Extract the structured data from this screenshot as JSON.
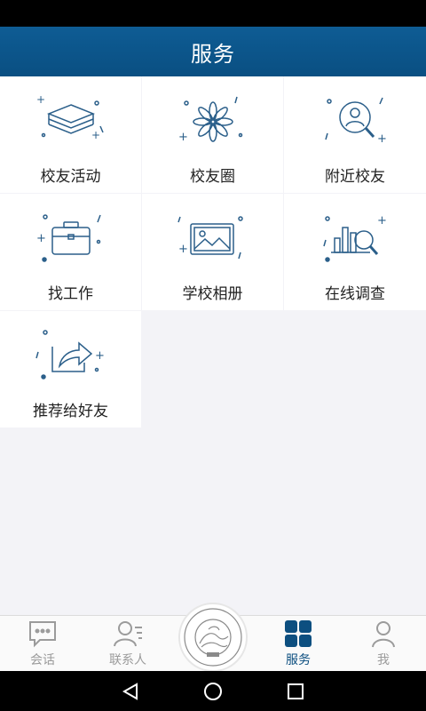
{
  "header": {
    "title": "服务"
  },
  "services": [
    {
      "label": "校友活动",
      "icon": "layers-icon"
    },
    {
      "label": "校友圈",
      "icon": "flower-icon"
    },
    {
      "label": "附近校友",
      "icon": "person-search-icon"
    },
    {
      "label": "找工作",
      "icon": "briefcase-icon"
    },
    {
      "label": "学校相册",
      "icon": "photo-album-icon"
    },
    {
      "label": "在线调查",
      "icon": "chart-search-icon"
    },
    {
      "label": "推荐给好友",
      "icon": "share-icon"
    }
  ],
  "tabbar": {
    "items": [
      {
        "label": "会话",
        "icon": "chat-icon"
      },
      {
        "label": "联系人",
        "icon": "contacts-icon"
      },
      {
        "label": "",
        "icon": "university-logo-icon"
      },
      {
        "label": "服务",
        "icon": "services-grid-icon",
        "active": true
      },
      {
        "label": "我",
        "icon": "user-icon"
      }
    ]
  },
  "colors": {
    "header_bg": "#0a4f82",
    "accent": "#0d4f80",
    "icon_stroke": "#2b5f8a",
    "inactive_tab": "#9b9b9b"
  }
}
